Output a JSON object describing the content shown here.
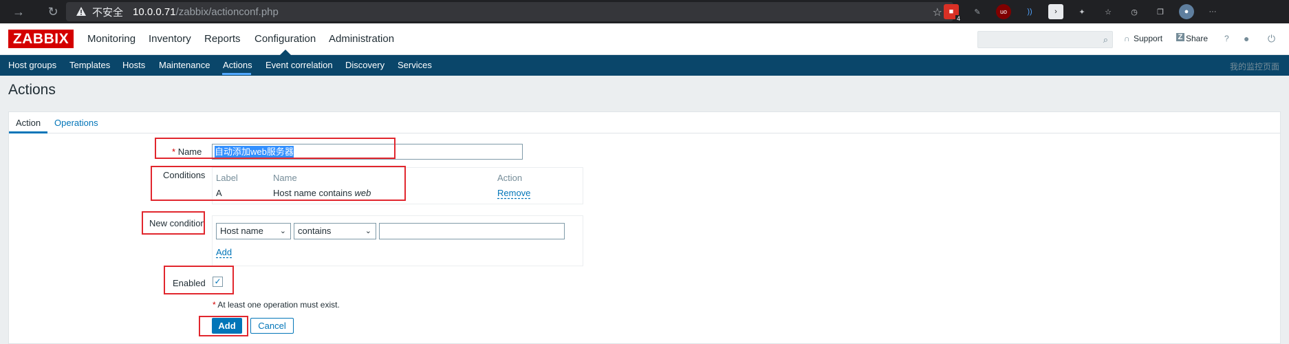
{
  "browser": {
    "insecure_label": "不安全",
    "url_host": "10.0.0.71",
    "url_path": "/zabbix/actionconf.php",
    "extension_badge": "4",
    "extension_label": "uo"
  },
  "header": {
    "logo": "ZABBIX",
    "menu": [
      "Monitoring",
      "Inventory",
      "Reports",
      "Configuration",
      "Administration"
    ],
    "support": "Support",
    "share": "Share",
    "help": "?"
  },
  "subnav": {
    "items": [
      "Host groups",
      "Templates",
      "Hosts",
      "Maintenance",
      "Actions",
      "Event correlation",
      "Discovery",
      "Services"
    ],
    "right_text": "我的监控页面"
  },
  "page": {
    "title": "Actions",
    "tabs": [
      "Action",
      "Operations"
    ]
  },
  "form": {
    "name_label": "Name",
    "name_required": "*",
    "name_value": "自动添加web服务器",
    "conditions_label": "Conditions",
    "conditions_headers": [
      "Label",
      "Name",
      "Action"
    ],
    "condition_row": {
      "label": "A",
      "name_prefix": "Host name contains ",
      "name_value": "web",
      "action": "Remove"
    },
    "new_condition_label": "New condition",
    "new_condition_type": "Host name",
    "new_condition_operator": "contains",
    "new_condition_value": "",
    "new_condition_add": "Add",
    "enabled_label": "Enabled",
    "enabled_checked": true,
    "warning_required": "*",
    "warning_text": "At least one operation must exist.",
    "add_button": "Add",
    "cancel_button": "Cancel"
  },
  "colors": {
    "logo_red": "#d40000",
    "subnav_blue": "#0a466a",
    "link_blue": "#0275b8",
    "highlight_red": "#e1262d"
  }
}
